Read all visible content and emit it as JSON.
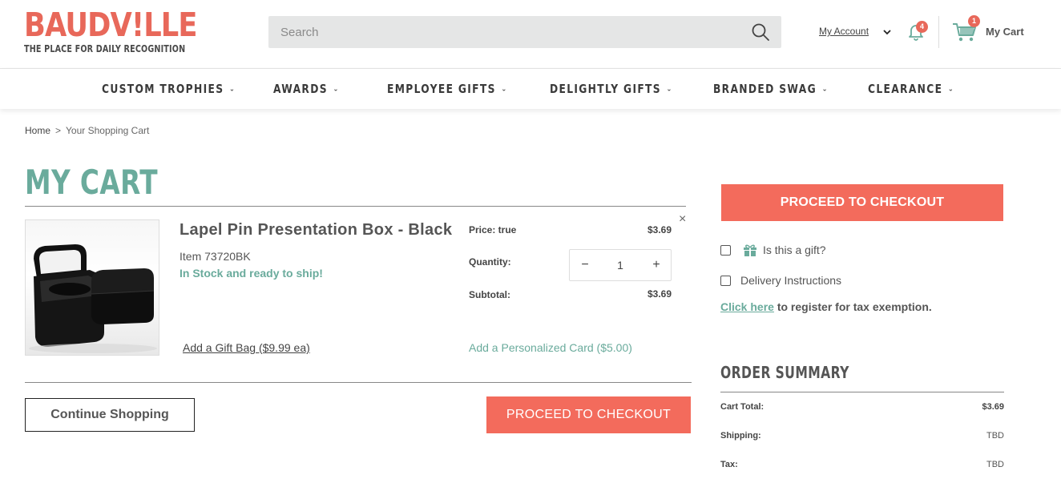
{
  "brand": {
    "logo_text": "BAUDV!LLE",
    "tagline": "THE PLACE FOR DAILY RECOGNITION"
  },
  "search": {
    "placeholder": "Search"
  },
  "account": {
    "label": "My Account",
    "notification_count": "4",
    "cart_count": "1",
    "cart_label": "My Cart"
  },
  "nav": {
    "items": [
      {
        "label": "CUSTOM TROPHIES"
      },
      {
        "label": "AWARDS"
      },
      {
        "label": "EMPLOYEE GIFTS"
      },
      {
        "label": "DELIGHTLY GIFTS"
      },
      {
        "label": "BRANDED SWAG"
      },
      {
        "label": "CLEARANCE"
      }
    ]
  },
  "breadcrumb": {
    "home": "Home",
    "separator": ">",
    "current": "Your Shopping Cart"
  },
  "page_title": "MY CART",
  "cart_item": {
    "name": "Lapel Pin Presentation Box - Black",
    "sku": "Item 73720BK",
    "stock": "In Stock and ready to ship!",
    "gift_bag": "Add a Gift Bag ($9.99 ea)",
    "price_label": "Price: true",
    "price_value": "$3.69",
    "quantity_label": "Quantity:",
    "quantity": "1",
    "subtotal_label": "Subtotal:",
    "subtotal_value": "$3.69",
    "personalized_card": "Add a Personalized Card ($5.00)",
    "remove": "×"
  },
  "actions": {
    "continue_shopping": "Continue Shopping",
    "proceed_checkout": "PROCEED TO CHECKOUT"
  },
  "sidebar": {
    "proceed_checkout": "PROCEED TO CHECKOUT",
    "gift_label": "Is this a gift?",
    "delivery_label": "Delivery Instructions",
    "tax_link": "Click here",
    "tax_text": " to register for tax exemption."
  },
  "order_summary": {
    "title": "ORDER SUMMARY",
    "rows": [
      {
        "label": "Cart Total:",
        "value": "$3.69"
      },
      {
        "label": "Shipping:",
        "value": "TBD"
      },
      {
        "label": "Tax:",
        "value": "TBD"
      }
    ]
  },
  "colors": {
    "accent_coral": "#f36b5c",
    "accent_teal": "#6aab9c",
    "logo": "#e8685a"
  },
  "icons": {
    "search": "search-icon",
    "chevron": "chevron-down-icon",
    "bell": "bell-icon",
    "cart": "cart-icon",
    "gift": "gift-icon",
    "close": "close-icon",
    "minus": "minus-icon",
    "plus": "plus-icon"
  }
}
